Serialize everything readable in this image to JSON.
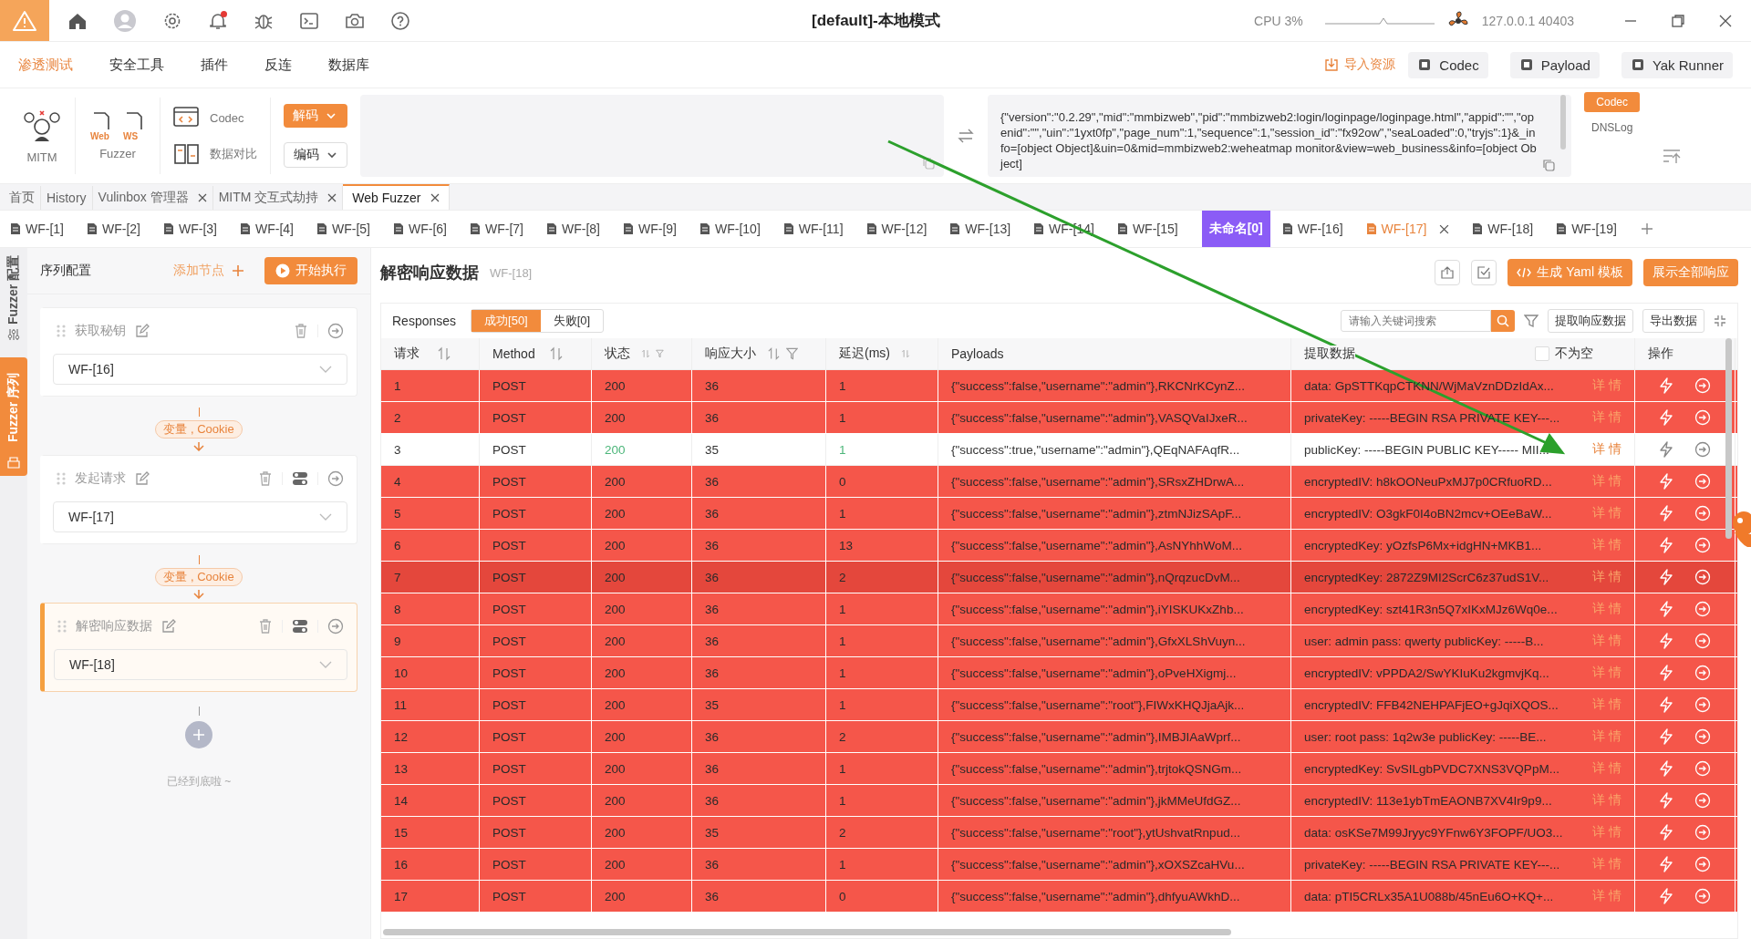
{
  "title_bar": {
    "title": "[default]-本地模式",
    "cpu": "CPU 3%",
    "host": "127.0.0.1 40403",
    "notification_dot": true
  },
  "menu": [
    {
      "label": "渗透测试",
      "selected": true
    },
    {
      "label": "安全工具",
      "selected": false
    },
    {
      "label": "插件",
      "selected": false
    },
    {
      "label": "反连",
      "selected": false
    },
    {
      "label": "数据库",
      "selected": false
    }
  ],
  "menu_actions": [
    {
      "label": "导入资源",
      "kind": "link"
    },
    {
      "label": "Codec",
      "kind": "button"
    },
    {
      "label": "Payload",
      "kind": "button"
    },
    {
      "label": "Yak Runner",
      "kind": "button"
    }
  ],
  "toolbar": {
    "mitm": "MITM",
    "fuzzer": "Fuzzer",
    "web": "Web",
    "ws": "WS",
    "codec": "Codec",
    "compare": "数据对比"
  },
  "codec": {
    "decode": "解码",
    "encode": "编码",
    "output": "{\"version\":\"0.2.29\",\"mid\":\"mmbizweb\",\"pid\":\"mmbizweb2:login/loginpage/loginpage.html\",\"appid\":\"\",\"openid\":\"\",\"uin\":\"1yxt0fp\",\"page_num\":1,\"sequence\":1,\"session_id\":\"fx92ow\",\"seaLoaded\":0,\"tryjs\":1}&_info=[object Object]&uin=0&mid=mmbizweb2:weheatmap monitor&view=web_business&info=[object Object]",
    "tags": [
      {
        "label": "Codec",
        "selected": true
      },
      {
        "label": "DNSLog",
        "selected": false
      }
    ]
  },
  "page_tabs": [
    {
      "label": "首页",
      "closable": false,
      "selected": false
    },
    {
      "label": "History",
      "closable": false,
      "selected": false
    },
    {
      "label": "Vulinbox 管理器",
      "closable": true,
      "selected": false
    },
    {
      "label": "MITM 交互式劫持",
      "closable": true,
      "selected": false
    },
    {
      "label": "Web Fuzzer",
      "closable": true,
      "selected": true
    }
  ],
  "fuzzer_tabs": [
    {
      "label": "WF-[1]",
      "kind": "tab",
      "selected": false
    },
    {
      "label": "WF-[2]",
      "kind": "tab",
      "selected": false
    },
    {
      "label": "WF-[3]",
      "kind": "tab",
      "selected": false
    },
    {
      "label": "WF-[4]",
      "kind": "tab",
      "selected": false
    },
    {
      "label": "WF-[5]",
      "kind": "tab",
      "selected": false
    },
    {
      "label": "WF-[6]",
      "kind": "tab",
      "selected": false
    },
    {
      "label": "WF-[7]",
      "kind": "tab",
      "selected": false
    },
    {
      "label": "WF-[8]",
      "kind": "tab",
      "selected": false
    },
    {
      "label": "WF-[9]",
      "kind": "tab",
      "selected": false
    },
    {
      "label": "WF-[10]",
      "kind": "tab",
      "selected": false
    },
    {
      "label": "WF-[11]",
      "kind": "tab",
      "selected": false
    },
    {
      "label": "WF-[12]",
      "kind": "tab",
      "selected": false
    },
    {
      "label": "WF-[13]",
      "kind": "tab",
      "selected": false
    },
    {
      "label": "WF-[14]",
      "kind": "tab",
      "selected": false
    },
    {
      "label": "WF-[15]",
      "kind": "tab",
      "selected": false
    },
    {
      "label": "未命名[0]",
      "kind": "group",
      "selected": false
    },
    {
      "label": "WF-[16]",
      "kind": "tab",
      "selected": false
    },
    {
      "label": "WF-[17]",
      "kind": "tab",
      "selected": true
    },
    {
      "label": "WF-[18]",
      "kind": "tab",
      "selected": false
    },
    {
      "label": "WF-[19]",
      "kind": "tab",
      "selected": false
    }
  ],
  "side_tabs": [
    {
      "label": "Fuzzer 配置",
      "selected": false
    },
    {
      "label": "Fuzzer 序列",
      "selected": true
    }
  ],
  "sequence": {
    "title": "序列配置",
    "add": "添加节点",
    "run": "开始执行",
    "end_text": "已经到底啦 ~",
    "nodes": [
      {
        "name": "获取秘钥",
        "target": "WF-[16]",
        "toggle": false,
        "selected": false
      },
      {
        "name": "发起请求",
        "target": "WF-[17]",
        "toggle": true,
        "selected": false
      },
      {
        "name": "解密响应数据",
        "target": "WF-[18]",
        "toggle": true,
        "selected": true
      }
    ],
    "links": [
      "变量 , Cookie",
      "变量 , Cookie"
    ]
  },
  "results": {
    "title": "解密响应数据",
    "subtitle": "WF-[18]",
    "yaml": "生成 Yaml 模板",
    "show_all": "展示全部响应",
    "responses": "Responses",
    "filters": [
      {
        "label": "成功[50]",
        "selected": true
      },
      {
        "label": "失败[0]",
        "selected": false
      }
    ],
    "search": {
      "placeholder": "请输入关键词搜索"
    },
    "actions": [
      "提取响应数据",
      "导出数据"
    ]
  },
  "table": {
    "columns": [
      {
        "label": "请求",
        "sortable": true,
        "filterable": false
      },
      {
        "label": "Method",
        "sortable": true,
        "filterable": false
      },
      {
        "label": "状态",
        "sortable": true,
        "filterable": true
      },
      {
        "label": "响应大小",
        "sortable": true,
        "filterable": true
      },
      {
        "label": "延迟(ms)",
        "sortable": true,
        "filterable": false
      },
      {
        "label": "Payloads",
        "sortable": false,
        "filterable": false
      },
      {
        "label": "提取数据",
        "sortable": false,
        "filterable": false
      },
      {
        "label": "操作",
        "sortable": false,
        "filterable": false
      }
    ],
    "not_empty": {
      "label": "不为空",
      "checked": false
    },
    "rows": [
      {
        "request": "1",
        "method": "POST",
        "status": "200",
        "size": "36",
        "delay": "1",
        "payload": "{\"success\":false,\"username\":\"admin\"},RKCNrKCynZ...",
        "extracted": "data: GpSTTKqpCTKNN/WjMaVznDDzIdAx...",
        "detail": "详 情",
        "success": false,
        "selected": false
      },
      {
        "request": "2",
        "method": "POST",
        "status": "200",
        "size": "36",
        "delay": "1",
        "payload": "{\"success\":false,\"username\":\"admin\"},VASQVaIJxeR...",
        "extracted": "privateKey: -----BEGIN RSA PRIVATE KEY---...",
        "detail": "详 情",
        "success": false,
        "selected": false
      },
      {
        "request": "3",
        "method": "POST",
        "status": "200",
        "size": "35",
        "delay": "1",
        "payload": "{\"success\":true,\"username\":\"admin\"},QEqNAFAqfR...",
        "extracted": "publicKey: -----BEGIN PUBLIC KEY----- MII...",
        "detail": "详 情",
        "success": true,
        "selected": false
      },
      {
        "request": "4",
        "method": "POST",
        "status": "200",
        "size": "36",
        "delay": "0",
        "payload": "{\"success\":false,\"username\":\"admin\"},SRsxZHDrwA...",
        "extracted": "encryptedIV: h8kOONeuPxMJ7p0CRfuoRD...",
        "detail": "详 情",
        "success": false,
        "selected": false
      },
      {
        "request": "5",
        "method": "POST",
        "status": "200",
        "size": "36",
        "delay": "1",
        "payload": "{\"success\":false,\"username\":\"admin\"},ztmNJizSApF...",
        "extracted": "encryptedIV: O3gkF0I4oBN2mcv+OEeBaW...",
        "detail": "详 情",
        "success": false,
        "selected": false
      },
      {
        "request": "6",
        "method": "POST",
        "status": "200",
        "size": "36",
        "delay": "13",
        "payload": "{\"success\":false,\"username\":\"admin\"},AsNYhhWoM...",
        "extracted": "encryptedKey: yOzfsP6Mx+idgHN+MKB1...",
        "detail": "详 情",
        "success": false,
        "selected": false
      },
      {
        "request": "7",
        "method": "POST",
        "status": "200",
        "size": "36",
        "delay": "2",
        "payload": "{\"success\":false,\"username\":\"admin\"},nQrqzucDvM...",
        "extracted": "encryptedKey: 2872Z9MI2ScrC6z37udS1V...",
        "detail": "详 情",
        "success": false,
        "selected": true
      },
      {
        "request": "8",
        "method": "POST",
        "status": "200",
        "size": "36",
        "delay": "1",
        "payload": "{\"success\":false,\"username\":\"admin\"},iYISKUKxZhb...",
        "extracted": "encryptedKey: szt41R3n5Q7xIKxMJz6Wq0e...",
        "detail": "详 情",
        "success": false,
        "selected": false
      },
      {
        "request": "9",
        "method": "POST",
        "status": "200",
        "size": "36",
        "delay": "1",
        "payload": "{\"success\":false,\"username\":\"admin\"},GfxXLShVuyn...",
        "extracted": "user: admin pass: qwerty publicKey: -----B...",
        "detail": "详 情",
        "success": false,
        "selected": false
      },
      {
        "request": "10",
        "method": "POST",
        "status": "200",
        "size": "36",
        "delay": "1",
        "payload": "{\"success\":false,\"username\":\"admin\"},oPveHXigmj...",
        "extracted": "encryptedIV: vPPDA2/SwYKIuKu2kgmvjKq...",
        "detail": "详 情",
        "success": false,
        "selected": false
      },
      {
        "request": "11",
        "method": "POST",
        "status": "200",
        "size": "35",
        "delay": "1",
        "payload": "{\"success\":false,\"username\":\"root\"},FIWxKHQJjaAjk...",
        "extracted": "encryptedIV: FFB42NEHPAFjEO+gJqiXQOS...",
        "detail": "详 情",
        "success": false,
        "selected": false
      },
      {
        "request": "12",
        "method": "POST",
        "status": "200",
        "size": "36",
        "delay": "2",
        "payload": "{\"success\":false,\"username\":\"admin\"},IMBJIAaWprf...",
        "extracted": "user: root pass: 1q2w3e publicKey: -----BE...",
        "detail": "详 情",
        "success": false,
        "selected": false
      },
      {
        "request": "13",
        "method": "POST",
        "status": "200",
        "size": "36",
        "delay": "1",
        "payload": "{\"success\":false,\"username\":\"admin\"},trjtokQSNGm...",
        "extracted": "encryptedKey: SvSILgbPVDC7XNS3VQPpM...",
        "detail": "详 情",
        "success": false,
        "selected": false
      },
      {
        "request": "14",
        "method": "POST",
        "status": "200",
        "size": "36",
        "delay": "1",
        "payload": "{\"success\":false,\"username\":\"admin\"},jkMMeUfdGZ...",
        "extracted": "encryptedIV: 113e1ybTmEAONB7XV4Ir9p9...",
        "detail": "详 情",
        "success": false,
        "selected": false
      },
      {
        "request": "15",
        "method": "POST",
        "status": "200",
        "size": "35",
        "delay": "2",
        "payload": "{\"success\":false,\"username\":\"root\"},ytUshvatRnpud...",
        "extracted": "data: osKSe7M99Jryyc9YFnw6Y3FOPF/UO3...",
        "detail": "详 情",
        "success": false,
        "selected": false
      },
      {
        "request": "16",
        "method": "POST",
        "status": "200",
        "size": "36",
        "delay": "1",
        "payload": "{\"success\":false,\"username\":\"admin\"},xOXSZcaHVu...",
        "extracted": "privateKey: -----BEGIN RSA PRIVATE KEY---...",
        "detail": "详 情",
        "success": false,
        "selected": false
      },
      {
        "request": "17",
        "method": "POST",
        "status": "200",
        "size": "36",
        "delay": "0",
        "payload": "{\"success\":false,\"username\":\"admin\"},dhfyuAWkhD...",
        "extracted": "data: pTI5CRLx35A1U088b/45nEu6O+KQ+...",
        "detail": "详 情",
        "success": false,
        "selected": false
      }
    ]
  }
}
